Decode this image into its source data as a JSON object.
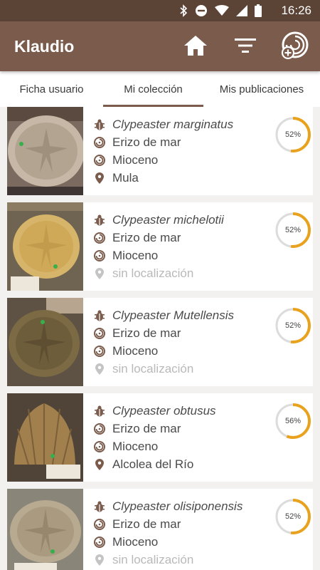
{
  "status_bar": {
    "time": "16:26"
  },
  "app_bar": {
    "title": "Klaudio"
  },
  "tabs": [
    {
      "label": "Ficha usuario"
    },
    {
      "label": "Mi colección"
    },
    {
      "label": "Mis publicaciones"
    }
  ],
  "colors": {
    "status_bar": "#5b4336",
    "app_bar": "#7a5b4c",
    "progress": "#e8a21e",
    "progress_track": "#dcdcdc",
    "icon": "#7a5b4c"
  },
  "items": [
    {
      "name": "Clypeaster marginatus",
      "group": "Erizo de mar",
      "period": "Mioceno",
      "location": "Mula",
      "has_location": true,
      "progress": 52,
      "progress_label": "52%"
    },
    {
      "name": "Clypeaster michelotii",
      "group": "Erizo de mar",
      "period": "Mioceno",
      "location": "sin localización",
      "has_location": false,
      "progress": 52,
      "progress_label": "52%"
    },
    {
      "name": "Clypeaster Mutellensis",
      "group": "Erizo de mar",
      "period": "Mioceno",
      "location": "sin localización",
      "has_location": false,
      "progress": 52,
      "progress_label": "52%"
    },
    {
      "name": "Clypeaster obtusus",
      "group": "Erizo de mar",
      "period": "Mioceno",
      "location": "Alcolea del Río",
      "has_location": true,
      "progress": 56,
      "progress_label": "56%"
    },
    {
      "name": "Clypeaster olisiponensis",
      "group": "Erizo de mar",
      "period": "Mioceno",
      "location": "sin localización",
      "has_location": false,
      "progress": 52,
      "progress_label": "52%"
    }
  ]
}
